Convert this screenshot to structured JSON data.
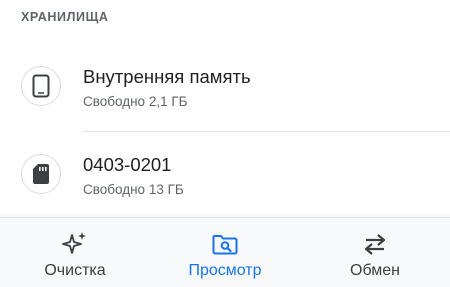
{
  "section": {
    "header": "ХРАНИЛИЩА"
  },
  "storage": [
    {
      "title": "Внутренняя память",
      "subtitle": "Свободно 2,1 ГБ",
      "icon": "phone-icon"
    },
    {
      "title": "0403-0201",
      "subtitle": "Свободно 13 ГБ",
      "icon": "sd-card-icon"
    }
  ],
  "bottom_nav": {
    "items": [
      {
        "label": "Очистка",
        "icon": "sparkle-icon",
        "active": false
      },
      {
        "label": "Просмотр",
        "icon": "folder-search-icon",
        "active": true
      },
      {
        "label": "Обмен",
        "icon": "swap-arrows-icon",
        "active": false
      }
    ]
  },
  "colors": {
    "accent": "#1a73e8",
    "text": "#202124",
    "secondary": "#5f6368"
  }
}
